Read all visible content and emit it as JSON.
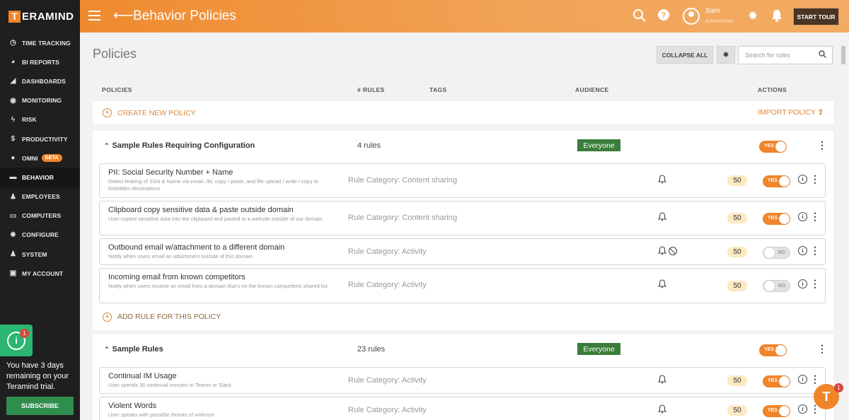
{
  "brand": {
    "logo_letter": "T",
    "logo_text": "ERAMIND"
  },
  "sidebar": {
    "items": [
      {
        "label": "TIME TRACKING",
        "icon": "clock-icon"
      },
      {
        "label": "BI REPORTS",
        "icon": "pie-chart-icon"
      },
      {
        "label": "DASHBOARDS",
        "icon": "area-chart-icon"
      },
      {
        "label": "MONITORING",
        "icon": "eye-icon"
      },
      {
        "label": "RISK",
        "icon": "lightning-icon"
      },
      {
        "label": "PRODUCTIVITY",
        "icon": "dollar-icon"
      },
      {
        "label": "OMNI",
        "icon": "lightbulb-icon",
        "badge": "BETA"
      },
      {
        "label": "BEHAVIOR",
        "icon": "gamepad-icon",
        "active": true
      },
      {
        "label": "EMPLOYEES",
        "icon": "users-icon"
      },
      {
        "label": "COMPUTERS",
        "icon": "monitor-icon"
      },
      {
        "label": "CONFIGURE",
        "icon": "gear-icon"
      },
      {
        "label": "SYSTEM",
        "icon": "user-gear-icon"
      },
      {
        "label": "MY ACCOUNT",
        "icon": "id-card-icon"
      }
    ],
    "trial": {
      "badge": "1",
      "icon_letter": "i",
      "text": "You have 3 days remaining on your Teramind trial.",
      "subscribe": "SUBSCRIBE"
    }
  },
  "header": {
    "title": "Behavior Policies",
    "user_name": "Sam",
    "user_role": "Administrator",
    "start_tour": "START TOUR"
  },
  "toolbar": {
    "heading": "Policies",
    "collapse_all": "COLLAPSE ALL",
    "search_placeholder": "Search for rules"
  },
  "columns": {
    "policies": "POLICIES",
    "rules": "# RULES",
    "tags": "TAGS",
    "audience": "AUDIENCE",
    "actions": "ACTIONS"
  },
  "create_policy": "CREATE NEW POLICY",
  "import_policy": "IMPORT POLICY",
  "add_rule": "ADD RULE FOR THIS POLICY",
  "policies": [
    {
      "title": "Sample Rules Requiring Configuration",
      "rule_count": "4 rules",
      "audience": "Everyone",
      "enabled_label": "YES",
      "rules": [
        {
          "name": "PII: Social Security Number + Name",
          "desc": "Detect leaking of SSN & Name via email, IM, copy / paste, and file upload / write / copy to forbidden destinations",
          "category": "Rule Category: Content sharing",
          "score": "50",
          "toggle": "YES",
          "blocked": false
        },
        {
          "name": "Clipboard copy sensitive data & paste outside domain",
          "desc": "User copied sensitive data into the clipboard and pasted to a website outside of our domain",
          "category": "Rule Category: Content sharing",
          "score": "50",
          "toggle": "YES",
          "blocked": false
        },
        {
          "name": "Outbound email w/attachment to a different domain",
          "desc": "Notify when users email an attachment outside of this domain",
          "category": "Rule Category: Activity",
          "score": "50",
          "toggle": "NO",
          "blocked": true
        },
        {
          "name": "Incoming email from known competitors",
          "desc": "Notify when users receive an email from a domain that's on the known competitors shared list",
          "category": "Rule Category: Activity",
          "score": "50",
          "toggle": "NO",
          "blocked": false
        }
      ]
    },
    {
      "title": "Sample Rules",
      "rule_count": "23 rules",
      "audience": "Everyone",
      "enabled_label": "YES",
      "rules": [
        {
          "name": "Continual IM Usage",
          "desc": "User spends 30 continual minutes in Teams or Slack",
          "category": "Rule Category: Activity",
          "score": "50",
          "toggle": "YES",
          "blocked": false
        },
        {
          "name": "Violent Words",
          "desc": "User speaks with possible threats of violence",
          "category": "Rule Category: Activity",
          "score": "50",
          "toggle": "YES",
          "blocked": false
        }
      ]
    }
  ],
  "chat": {
    "letter": "T",
    "badge": "1"
  },
  "colors": {
    "accent": "#f0852a",
    "audience_badge": "#3a7d3a",
    "sidebar_bg": "#1f1f1f"
  }
}
